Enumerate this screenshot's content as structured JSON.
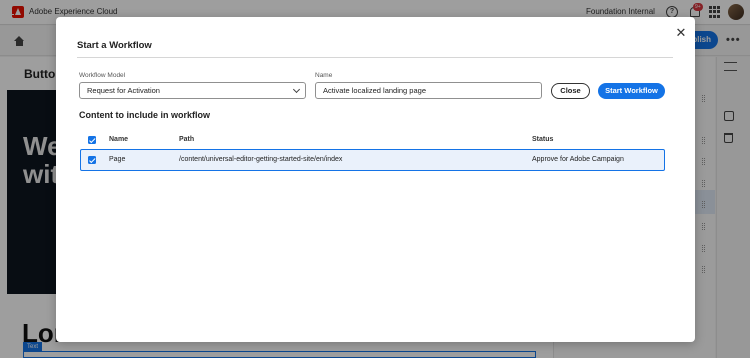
{
  "topbar": {
    "app_title": "Adobe Experience Cloud",
    "org_name": "Foundation Internal",
    "help_icon": "?",
    "notification_count": "9+",
    "icons": [
      "help-icon",
      "bell-icon",
      "apps-grid-icon",
      "avatar"
    ]
  },
  "editor": {
    "publish_label": "Publish",
    "more_label": "•••",
    "heading": "Button",
    "hero_text": "Wel with",
    "lorem": "Lor",
    "selection_tag": "Text"
  },
  "dialog": {
    "title": "Start a Workflow",
    "close_icon": "✕",
    "workflow_model_label": "Workflow Model",
    "workflow_model_value": "Request for Activation",
    "name_label": "Name",
    "name_value": "Activate localized landing page",
    "close_button": "Close",
    "start_button": "Start Workflow",
    "section_heading": "Content to include in workflow",
    "table": {
      "headers": {
        "name": "Name",
        "path": "Path",
        "status": "Status"
      },
      "rows": [
        {
          "checked": true,
          "name": "Page",
          "path": "/content/universal-editor-getting-started-site/en/index",
          "status": "Approve for Adobe Campaign"
        }
      ]
    }
  },
  "colors": {
    "accent": "#1473e6",
    "adobe_red": "#eb1000",
    "overlay": "rgba(0,0,0,0.38)"
  }
}
